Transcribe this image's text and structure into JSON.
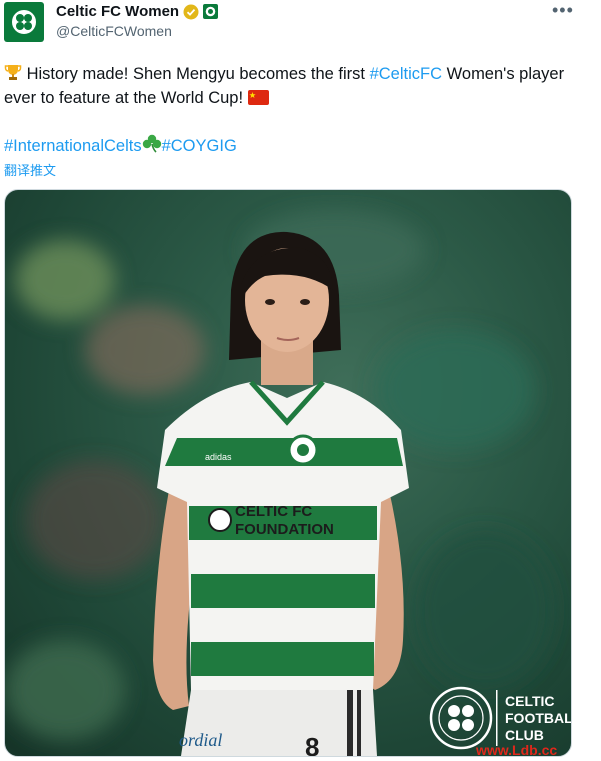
{
  "account": {
    "display_name": "Celtic FC Women",
    "handle": "@CelticFCWomen"
  },
  "tweet": {
    "line1_before": "History made! Shen Mengyu becomes the first ",
    "hashtag_celticfc": "#CelticFC",
    "line1_after": " Women's player ever to feature at the World Cup!",
    "hashtag_international": "#InternationalCelts",
    "hashtag_coygig": "#COYGIG"
  },
  "translate_label": "翻译推文",
  "media": {
    "shirt_sponsor_line1": "CELTIC FC",
    "shirt_sponsor_line2": "FOUNDATION",
    "logo_text_line1": "CELTIC",
    "logo_text_line2": "FOOTBALL",
    "logo_text_line3": "CLUB",
    "shorts_text": "ordial",
    "shirt_brand": "adidas"
  },
  "watermark": "www.Ldb.cc",
  "colors": {
    "link": "#1d9bf0",
    "celtic_green": "#0a7a3b",
    "text_secondary": "#536471"
  }
}
